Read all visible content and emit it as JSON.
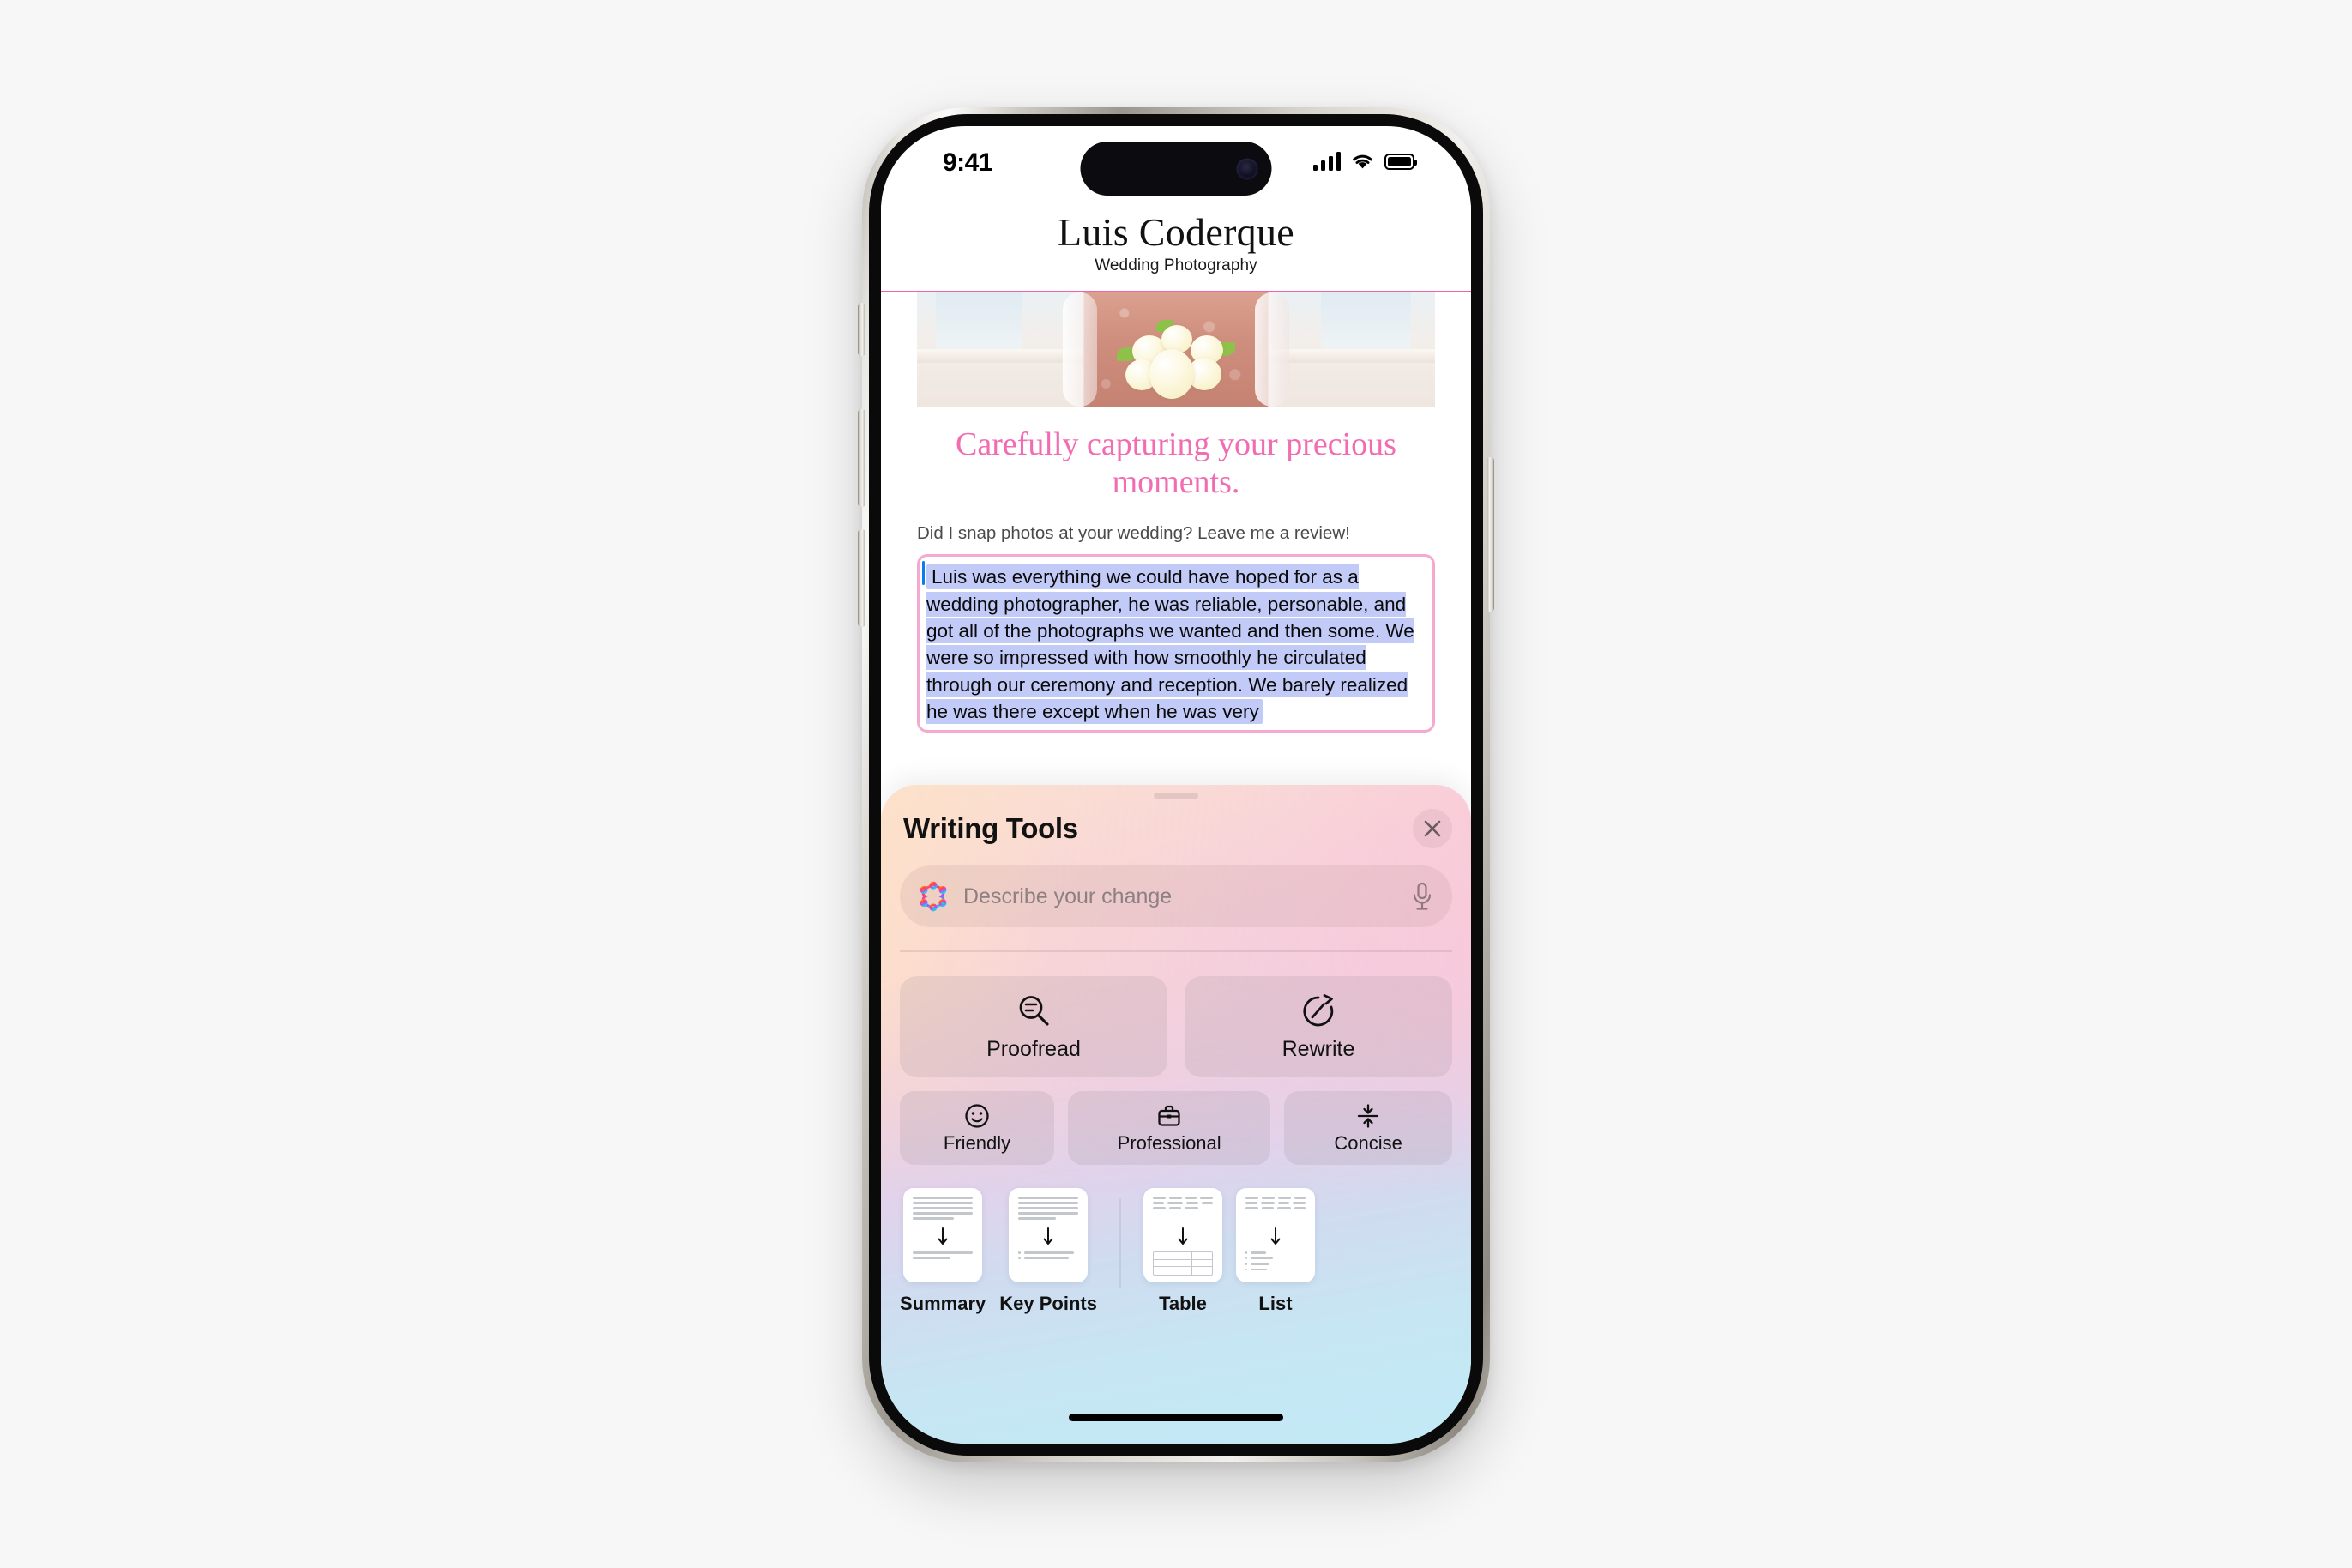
{
  "status_bar": {
    "time": "9:41",
    "signal_icon": "cellular-bars-icon",
    "wifi_icon": "wifi-icon",
    "battery_icon": "battery-full-icon"
  },
  "site": {
    "title": "Luis Coderque",
    "subtitle": "Wedding Photography",
    "accent_color": "#f062b0",
    "headline": "Carefully capturing your precious moments.",
    "headline_color": "#f26cb2",
    "prompt": "Did I snap photos at your wedding? Leave me a review!",
    "review_text": "Luis was everything we could have hoped for as a wedding photographer, he was reliable, personable, and got all of the photographs we wanted and then some. We were so impressed with how smoothly he circulated through our ceremony and reception. We barely realized he was there except when he was very",
    "review_selection_color": "#c2caf7",
    "review_border_color": "#f6a9cf",
    "caret_color": "#0a7bf0"
  },
  "writing_tools": {
    "title": "Writing Tools",
    "close_label": "Close",
    "search": {
      "placeholder": "Describe your change",
      "value": "",
      "leading_icon": "apple-intelligence-icon",
      "trailing_icon": "microphone-icon"
    },
    "primary_actions": [
      {
        "label": "Proofread",
        "icon": "proofread-magnifier-icon"
      },
      {
        "label": "Rewrite",
        "icon": "rewrite-circular-arrow-icon"
      }
    ],
    "tone_actions": [
      {
        "label": "Friendly",
        "icon": "smiley-face-icon"
      },
      {
        "label": "Professional",
        "icon": "briefcase-icon"
      },
      {
        "label": "Concise",
        "icon": "compress-arrows-icon"
      }
    ],
    "format_actions": [
      {
        "label": "Summary",
        "icon": "document-summary-icon"
      },
      {
        "label": "Key Points",
        "icon": "document-key-points-icon"
      },
      {
        "label": "Table",
        "icon": "document-table-icon"
      },
      {
        "label": "List",
        "icon": "document-list-icon"
      }
    ],
    "gradient_top": "#fbe3d0",
    "gradient_mid": "#f3cfdc",
    "gradient_bottom": "#c2eaf6"
  },
  "device": {
    "side_buttons": [
      "action-button",
      "volume-up-button",
      "volume-down-button",
      "power-button"
    ],
    "home_indicator": "home-indicator"
  }
}
